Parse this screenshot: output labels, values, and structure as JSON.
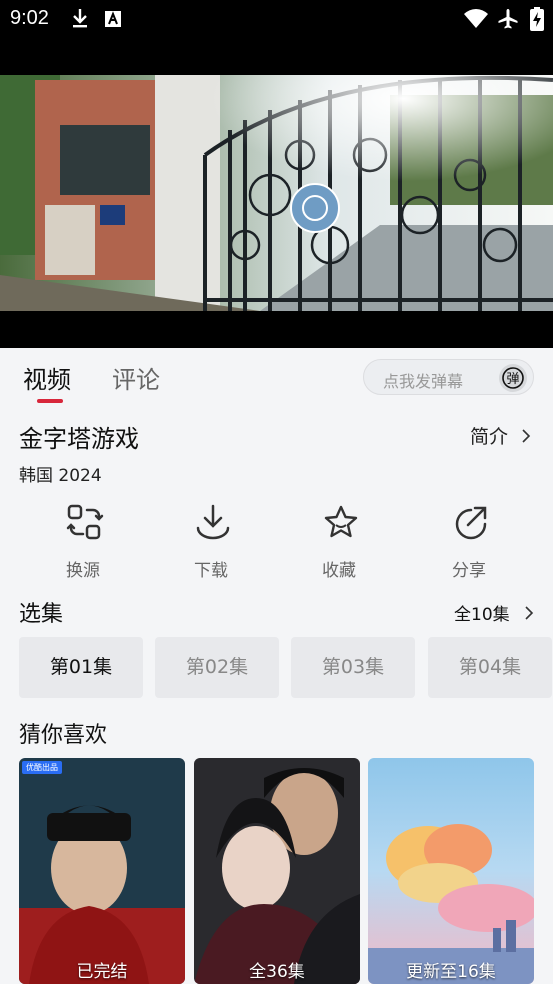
{
  "status_bar": {
    "time": "9:02"
  },
  "tabs": {
    "video": "视频",
    "comment": "评论"
  },
  "danmu": {
    "placeholder": "点我发弹幕",
    "toggle": "弹"
  },
  "show": {
    "title": "金字塔游戏",
    "intro_link": "简介",
    "meta": "韩国  2024"
  },
  "actions": [
    {
      "label": "换源",
      "icon": "switch-source-icon"
    },
    {
      "label": "下载",
      "icon": "download-icon"
    },
    {
      "label": "收藏",
      "icon": "star-icon"
    },
    {
      "label": "分享",
      "icon": "share-icon"
    }
  ],
  "episodes": {
    "title": "选集",
    "count_label": "全10集",
    "items": [
      "第01集",
      "第02集",
      "第03集",
      "第04集"
    ]
  },
  "recommend": {
    "title": "猜你喜欢",
    "items": [
      {
        "badge": "已完结",
        "tag": "优酷出品"
      },
      {
        "badge": "全36集"
      },
      {
        "badge": "更新至16集"
      }
    ]
  },
  "colors": {
    "accent": "#d8273b"
  }
}
